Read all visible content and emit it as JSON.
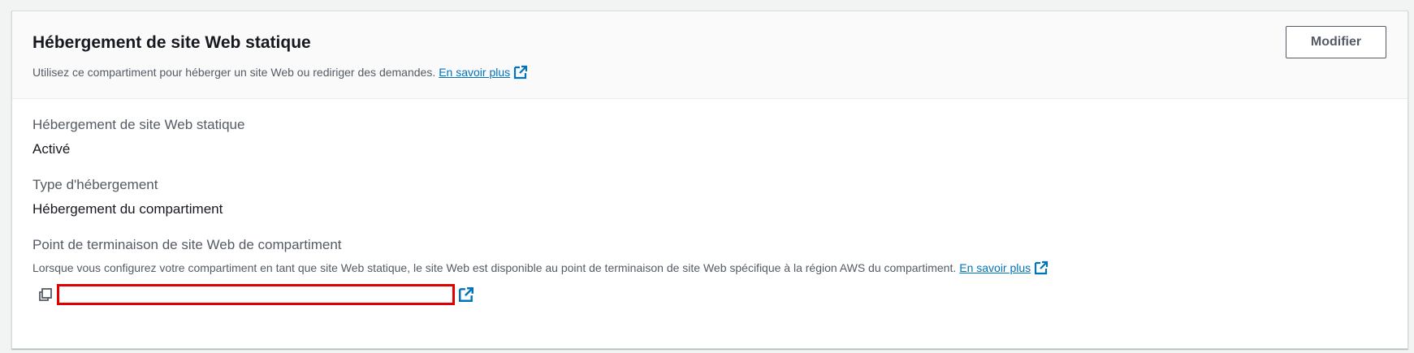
{
  "header": {
    "title": "Hébergement de site Web statique",
    "description": "Utilisez ce compartiment pour héberger un site Web ou rediriger des demandes.",
    "learn_more": "En savoir plus",
    "edit_label": "Modifier"
  },
  "fields": {
    "hosting": {
      "label": "Hébergement de site Web statique",
      "value": "Activé"
    },
    "type": {
      "label": "Type d'hébergement",
      "value": "Hébergement du compartiment"
    },
    "endpoint": {
      "label": "Point de terminaison de site Web de compartiment",
      "description": "Lorsque vous configurez votre compartiment en tant que site Web statique, le site Web est disponible au point de terminaison de site Web spécifique à la région AWS du compartiment.",
      "learn_more": "En savoir plus",
      "value": ""
    }
  },
  "icons": {
    "external": "external-link-icon",
    "copy": "copy-icon"
  },
  "colors": {
    "link": "#0073bb",
    "highlight": "#e00000"
  }
}
